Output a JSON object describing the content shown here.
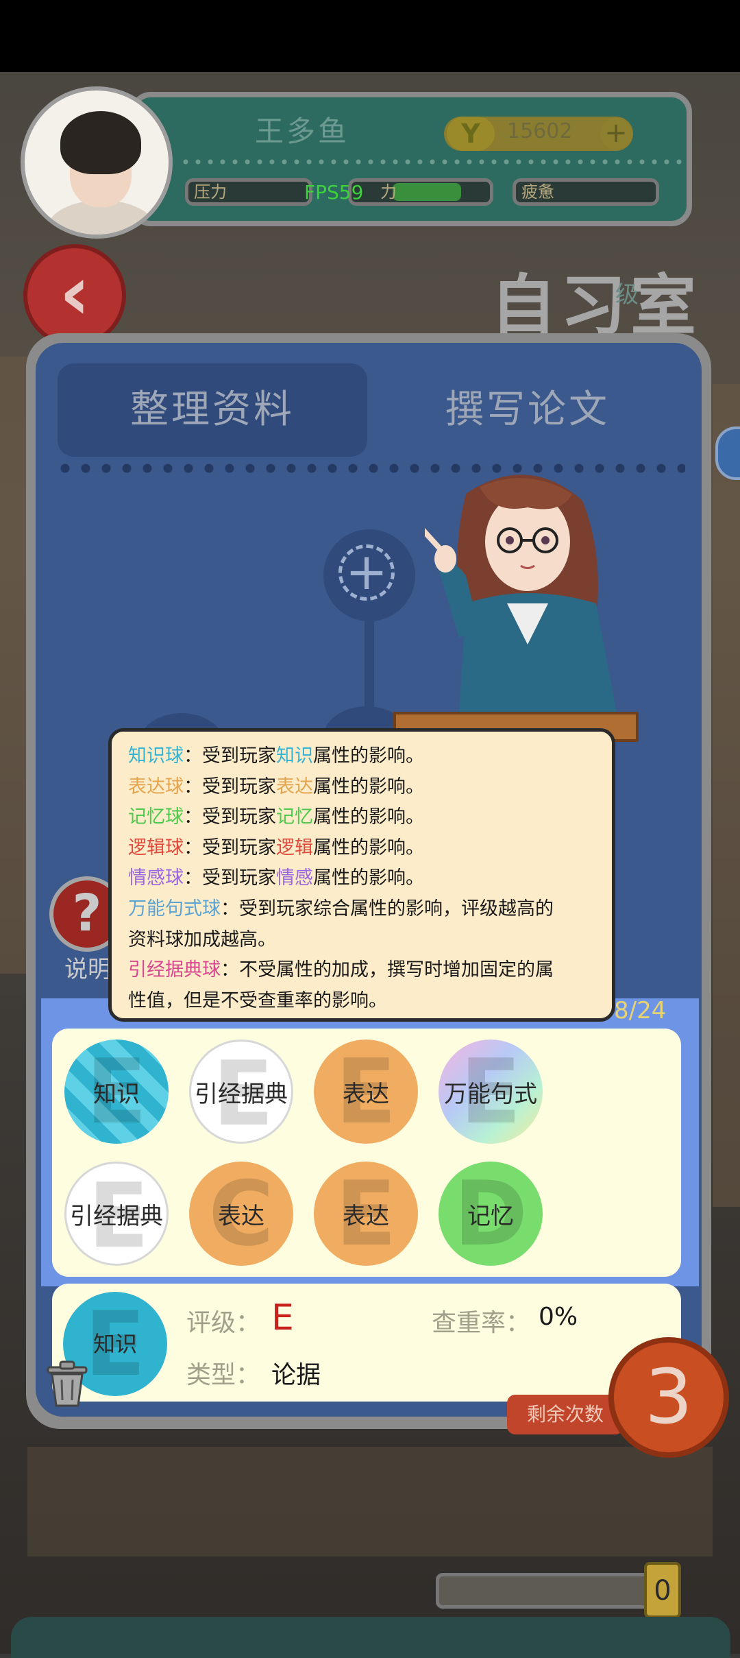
{
  "player": {
    "name": "王多鱼",
    "coins": "15602",
    "coin_symbol": "Y",
    "plus": "+"
  },
  "stats": {
    "stress": "压力",
    "energy": "力",
    "fatigue": "疲惫"
  },
  "fps": "FPS59",
  "room": {
    "title": "自习室",
    "subtitle": "级"
  },
  "tabs": [
    {
      "label": "整理资料",
      "active": true
    },
    {
      "label": "撰写论文",
      "active": false
    }
  ],
  "help": {
    "icon": "?",
    "label": "说明"
  },
  "tooltip": {
    "lines": [
      {
        "key": "知识球",
        "pre": "：受到玩家",
        "attr": "知识",
        "post": "属性的影响。"
      },
      {
        "key": "表达球",
        "pre": "：受到玩家",
        "attr": "表达",
        "post": "属性的影响。"
      },
      {
        "key": "记忆球",
        "pre": "：受到玩家",
        "attr": "记忆",
        "post": "属性的影响。"
      },
      {
        "key": "逻辑球",
        "pre": "：受到玩家",
        "attr": "逻辑",
        "post": "属性的影响。"
      },
      {
        "key": "情感球",
        "pre": "：受到玩家",
        "attr": "情感",
        "post": "属性的影响。"
      }
    ],
    "wanneng_key": "万能句式球",
    "wanneng_text_1": "：受到玩家综合属性的影响，评级越高的",
    "wanneng_text_2": "资料球加成越高。",
    "yinjing_key": "引经据典球",
    "yinjing_text_1": "：不受属性的加成，撰写时增加固定的属",
    "yinjing_text_2": "性值，但是不受查重率的影响。"
  },
  "capacity": "8/24",
  "inventory": [
    {
      "label": "知识",
      "grade": "E",
      "kind": "zhishi"
    },
    {
      "label": "引经据典",
      "grade": "E",
      "kind": "yinjing"
    },
    {
      "label": "表达",
      "grade": "E",
      "kind": "biaoda"
    },
    {
      "label": "万能句式",
      "grade": "E",
      "kind": "wanneng"
    },
    {
      "label": "引经据典",
      "grade": "E",
      "kind": "yinjing"
    },
    {
      "label": "表达",
      "grade": "C",
      "kind": "biaoda"
    },
    {
      "label": "表达",
      "grade": "E",
      "kind": "biaoda"
    },
    {
      "label": "记忆",
      "grade": "D",
      "kind": "jiyi"
    }
  ],
  "detail": {
    "ball_label": "知识",
    "ball_grade": "E",
    "grade_label": "评级：",
    "grade_value": "E",
    "duplicate_label": "查重率：",
    "duplicate_value": "0%",
    "type_label": "类型：",
    "type_value": "论据"
  },
  "remaining": {
    "label": "剩余次数",
    "value": "3"
  },
  "bottom": {
    "battery_value": "0"
  }
}
